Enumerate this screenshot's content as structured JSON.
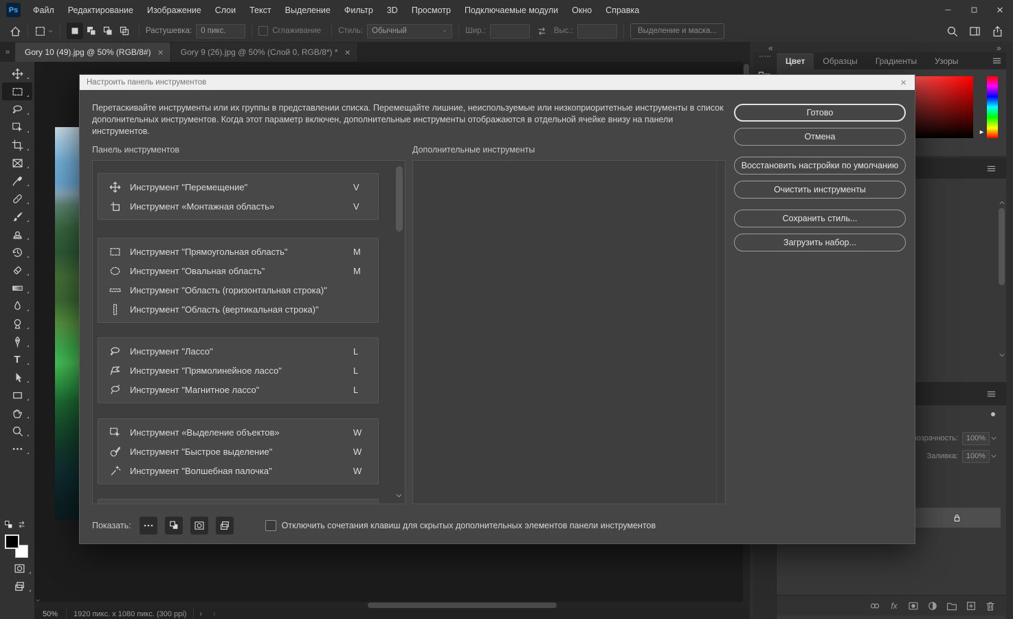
{
  "menu_bar": {
    "items": [
      "Файл",
      "Редактирование",
      "Изображение",
      "Слои",
      "Текст",
      "Выделение",
      "Фильтр",
      "3D",
      "Просмотр",
      "Подключаемые модули",
      "Окно",
      "Справка"
    ]
  },
  "options_bar": {
    "feather_label": "Растушевка:",
    "feather_value": "0 пикс.",
    "anti_alias_label": "Сглаживание",
    "style_label": "Стиль:",
    "style_value": "Обычный",
    "width_label": "Шир.:",
    "height_label": "Выс.:",
    "select_mask_label": "Выделение и маска..."
  },
  "document_tabs": [
    {
      "label": "Gory 10 (49).jpg @ 50% (RGB/8#)",
      "active": true
    },
    {
      "label": "Gory 9 (26).jpg @ 50% (Слой 0, RGB/8*) *",
      "active": false
    }
  ],
  "toolbar": {
    "selected_index": 1,
    "tools": [
      "move-icon",
      "rect-marquee-icon",
      "lasso-icon",
      "object-select-icon",
      "crop-icon",
      "frame-icon",
      "eyedropper-icon",
      "heal-icon",
      "brush-icon",
      "stamp-icon",
      "history-brush-icon",
      "eraser-icon",
      "gradient-icon",
      "blur-icon",
      "dodge-icon",
      "pen-icon",
      "type-icon",
      "path-select-icon",
      "shape-icon",
      "hand-icon",
      "zoom-icon",
      "ellipsis-icon"
    ]
  },
  "dialog": {
    "title": "Настроить панель инструментов",
    "description": "Перетаскивайте инструменты или их группы в представлении списка. Перемещайте лишние, неиспользуемые или низкоприоритетные инструменты в список дополнительных инструментов. Когда этот параметр включен, дополнительные инструменты отображаются в отдельной ячейке внизу на панели инструментов.",
    "left_list_title": "Панель инструментов",
    "right_list_title": "Дополнительные инструменты",
    "tool_groups": [
      {
        "tools": [
          {
            "icon": "move-icon",
            "label": "Инструмент \"Перемещение\"",
            "shortcut": "V"
          },
          {
            "icon": "artboard-icon",
            "label": "Инструмент «Монтажная область»",
            "shortcut": "V"
          }
        ]
      },
      {
        "tools": [
          {
            "icon": "rect-marquee-icon",
            "label": "Инструмент \"Прямоугольная область\"",
            "shortcut": "M"
          },
          {
            "icon": "ellipse-marquee-icon",
            "label": "Инструмент \"Овальная область\"",
            "shortcut": "M"
          },
          {
            "icon": "row-marquee-icon",
            "label": "Инструмент \"Область (горизонтальная строка)\"",
            "shortcut": ""
          },
          {
            "icon": "col-marquee-icon",
            "label": "Инструмент \"Область (вертикальная строка)\"",
            "shortcut": ""
          }
        ]
      },
      {
        "tools": [
          {
            "icon": "lasso-icon",
            "label": "Инструмент \"Лассо\"",
            "shortcut": "L"
          },
          {
            "icon": "poly-lasso-icon",
            "label": "Инструмент \"Прямолинейное лассо\"",
            "shortcut": "L"
          },
          {
            "icon": "magnetic-lasso-icon",
            "label": "Инструмент \"Магнитное лассо\"",
            "shortcut": "L"
          }
        ]
      },
      {
        "tools": [
          {
            "icon": "object-select-icon",
            "label": "Инструмент «Выделение объектов»",
            "shortcut": "W"
          },
          {
            "icon": "quick-select-icon",
            "label": "Инструмент \"Быстрое выделение\"",
            "shortcut": "W"
          },
          {
            "icon": "magic-wand-icon",
            "label": "Инструмент \"Волшебная палочка\"",
            "shortcut": "W"
          }
        ]
      },
      {
        "tools": [
          {
            "icon": "crop-icon",
            "label": "",
            "shortcut": ""
          }
        ]
      }
    ],
    "buttons": {
      "done": "Готово",
      "cancel": "Отмена",
      "restore": "Восстановить настройки по умолчанию",
      "clear": "Очистить инструменты",
      "save": "Сохранить стиль...",
      "load": "Загрузить набор..."
    },
    "show_label": "Показать:",
    "show_buttons": [
      "ellipsis-icon",
      "show-colors-icon",
      "quick-mask-icon",
      "screen-mode-icon"
    ],
    "checkbox_label": "Отключить сочетания клавиш для скрытых дополнительных элементов панели инструментов"
  },
  "panels": {
    "tabs": [
      "Цвет",
      "Образцы",
      "Градиенты",
      "Узоры"
    ],
    "active_tab": "Цвет",
    "layers": {
      "opacity_label": "Непрозрачность:",
      "opacity_value": "100%",
      "fill_label": "Заливка:",
      "fill_value": "100%",
      "filter_icons": [
        "adjust-icon",
        "type-icon",
        "frame-icon",
        "page-icon"
      ]
    },
    "bottom_icons": [
      "link-icon",
      "fx-icon",
      "mask-icon",
      "adjust-icon",
      "folder-icon",
      "plus-square-icon",
      "trash-icon"
    ]
  },
  "status_bar": {
    "zoom": "50%",
    "doc_info": "1920 пикс. x 1080 пикс. (300 ppi)"
  },
  "colors": {
    "foreground": "#000000",
    "background": "#ffffff",
    "color_panel_hue": "#ff0000"
  }
}
